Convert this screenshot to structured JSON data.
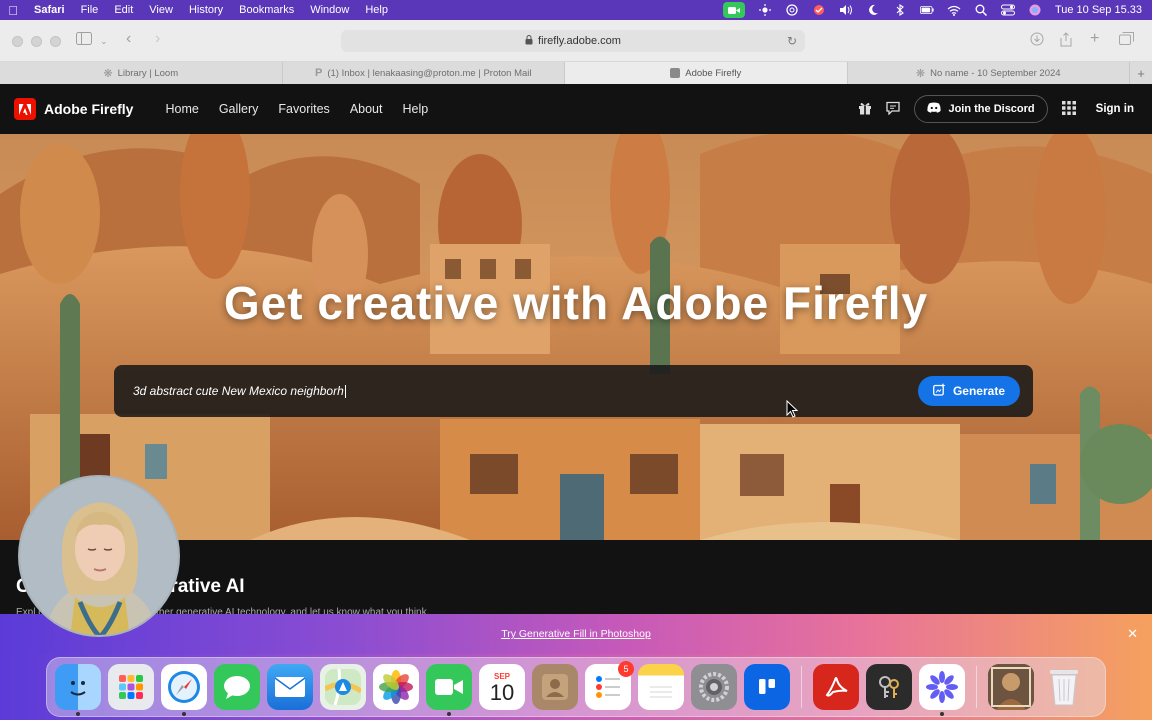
{
  "menubar": {
    "app": "Safari",
    "items": [
      "File",
      "Edit",
      "View",
      "History",
      "Bookmarks",
      "Window",
      "Help"
    ],
    "clock": "Tue 10 Sep  15.33"
  },
  "browser": {
    "url": "firefly.adobe.com",
    "tabs": [
      {
        "label": "Library | Loom"
      },
      {
        "label": "(1) Inbox | lenakaasing@proton.me | Proton Mail"
      },
      {
        "label": "Adobe Firefly"
      },
      {
        "label": "No name - 10 September 2024"
      }
    ]
  },
  "firefly": {
    "brand": "Adobe Firefly",
    "nav": [
      "Home",
      "Gallery",
      "Favorites",
      "About",
      "Help"
    ],
    "discord_label": "Join the Discord",
    "signin_label": "Sign in",
    "hero_title": "Get creative with Adobe Firefly",
    "prompt_value": "3d abstract cute New Mexico neighborh",
    "generate_label": "Generate",
    "section_title_left": "C",
    "section_title_right": "erative AI",
    "section_sub": "Expl                   ovations from Firefly and other generative AI technology, and let us know what you think."
  },
  "promo": {
    "link_label": "Try Generative Fill in Photoshop"
  },
  "dock": {
    "calendar_month": "SEP",
    "calendar_day": "10",
    "reminders_badge": "5"
  }
}
